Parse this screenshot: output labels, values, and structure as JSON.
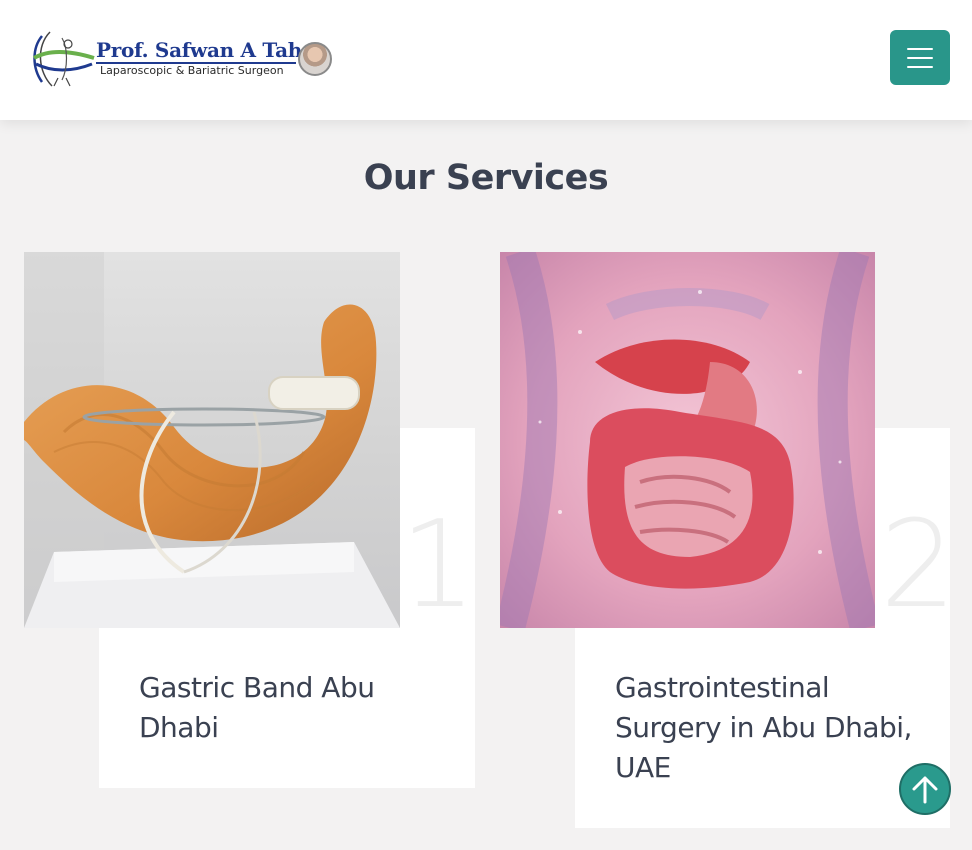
{
  "header": {
    "logo": {
      "name": "Prof. Safwan A Taha",
      "tagline": "Laparoscopic & Bariatric Surgeon"
    },
    "menu_icon": "hamburger-icon"
  },
  "services": {
    "title": "Our Services",
    "items": [
      {
        "number": "1",
        "title": "Gastric Band Abu Dhabi",
        "image": "gastric-band-model-image"
      },
      {
        "number": "2",
        "title": "Gastrointestinal Surgery in Abu Dhabi, UAE",
        "image": "digestive-system-image"
      }
    ]
  },
  "back_to_top_icon": "arrow-up-icon",
  "colors": {
    "accent": "#29968a",
    "heading": "#3a4151",
    "background": "#f3f2f2",
    "logo_blue": "#1f3a8f"
  }
}
